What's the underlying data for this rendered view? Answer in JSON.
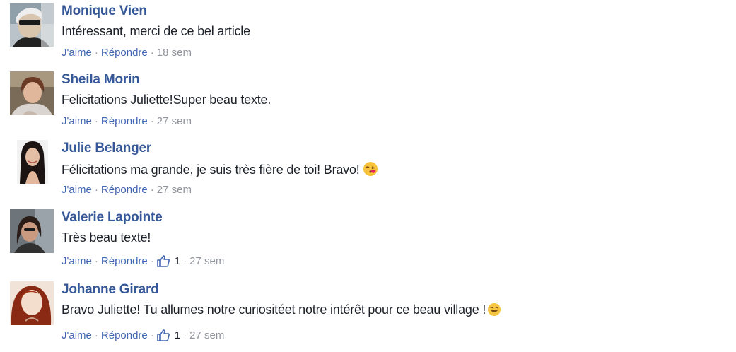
{
  "actions": {
    "like": "J'aime",
    "reply": "Répondre",
    "sep": "·"
  },
  "comments": [
    {
      "name": "Monique Vien",
      "text": "Intéressant, merci de ce bel article",
      "time": "18 sem"
    },
    {
      "name": "Sheila Morin",
      "text": "Felicitations Juliette!Super beau texte.",
      "time": "27 sem"
    },
    {
      "name": "Julie Belanger",
      "text": "Félicitations ma grande, je suis très fière de toi! Bravo!",
      "time": "27 sem",
      "emoji": "kissing-face"
    },
    {
      "name": "Valerie Lapointe",
      "text": "Très beau texte!",
      "time": "27 sem",
      "likes": "1",
      "reaction_icon": "thumbs-up"
    },
    {
      "name": "Johanne Girard",
      "text": "Bravo Juliette! Tu allumes notre curiositéet notre intérêt pour ce beau village !",
      "time": "27 sem",
      "likes": "1",
      "reaction_icon": "thumbs-up",
      "emoji": "smiling-face"
    }
  ],
  "colors": {
    "name": "#365899",
    "link": "#4267b2",
    "meta": "#90949c",
    "text": "#1d2129"
  }
}
